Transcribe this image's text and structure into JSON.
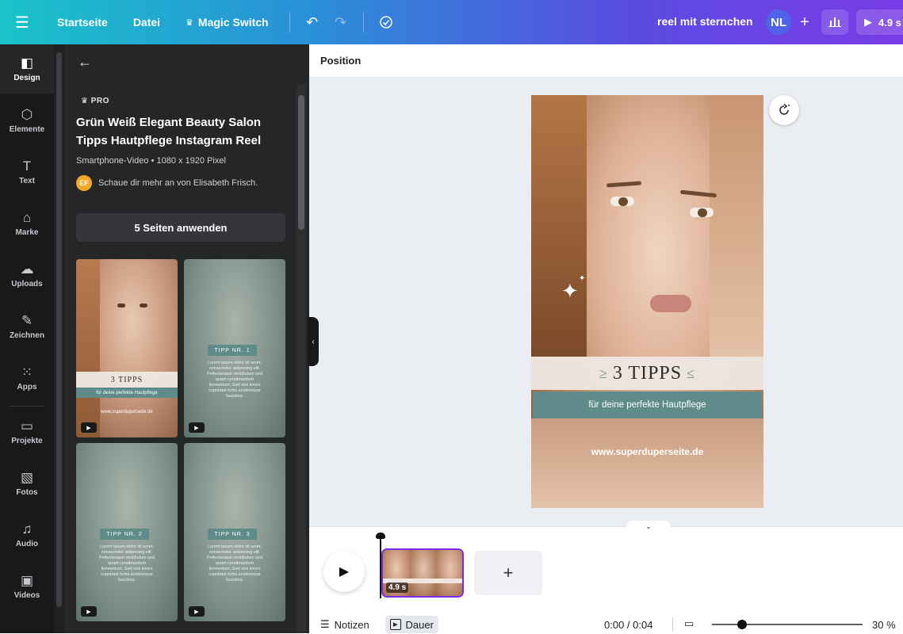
{
  "topbar": {
    "menu_icon": "hamburger-icon",
    "home": "Startseite",
    "file": "Datei",
    "magic_switch": "Magic Switch",
    "magic_icon": "crown-icon",
    "undo_icon": "undo-icon",
    "redo_icon": "redo-icon",
    "save_status_icon": "cloud-check-icon",
    "design_title": "reel mit sternchen",
    "avatar_initials": "NL",
    "add_icon": "plus-icon",
    "stats_icon": "bar-chart-icon",
    "play_label": "4.9 s",
    "accent_start": "#19c3c9",
    "accent_end": "#7a3ce6"
  },
  "rail": {
    "items": [
      {
        "label": "Design",
        "icon": "layout-icon"
      },
      {
        "label": "Elemente",
        "icon": "shapes-icon"
      },
      {
        "label": "Text",
        "icon": "text-icon"
      },
      {
        "label": "Marke",
        "icon": "brand-icon"
      },
      {
        "label": "Uploads",
        "icon": "cloud-upload-icon"
      },
      {
        "label": "Zeichnen",
        "icon": "draw-icon"
      },
      {
        "label": "Apps",
        "icon": "apps-grid-icon"
      },
      {
        "label": "Projekte",
        "icon": "folder-icon"
      },
      {
        "label": "Fotos",
        "icon": "image-icon"
      },
      {
        "label": "Audio",
        "icon": "music-icon"
      },
      {
        "label": "Videos",
        "icon": "video-icon"
      }
    ]
  },
  "panel": {
    "pro_label": "PRO",
    "title": "Grün Weiß Elegant Beauty Salon Tipps Hautpflege Instagram Reel",
    "subtitle": "Smartphone-Video • 1080 x 1920 Pixel",
    "author_initials": "EF",
    "author_text": "Schaue dir mehr an von Elisabeth Frisch.",
    "apply_button": "5 Seiten anwenden",
    "thumbnails": [
      {
        "heading": "3 TIPPS",
        "sub": "für deine perfekte Hautpflege",
        "url": "www.superduperseite.de"
      },
      {
        "tipp": "TIPP NR. 1",
        "body": "Lorem ipsum dolor sit amet, consectetur adipiscing elit. Pellentesque vestibulum sed quam condimentum fermentum. Sed non lorem cupidatat fortia scelerisque faucibus."
      },
      {
        "tipp": "TIPP NR. 2",
        "body": "Lorem ipsum dolor sit amet, consectetur adipiscing elit. Pellentesque vestibulum sed quam condimentum fermentum. Sed non lorem cupidatat fortia scelerisque faucibus."
      },
      {
        "tipp": "TIPP NR. 3",
        "body": "Lorem ipsum dolor sit amet, consectetur adipiscing elit. Pellentesque vestibulum sed quam condimentum fermentum. Sed non lorem cupidatat fortia scelerisque faucibus."
      }
    ]
  },
  "editor": {
    "toolbar_position": "Position",
    "page": {
      "heading": "3 TIPPS",
      "subheading": "für deine perfekte Hautpflege",
      "url": "www.superduperseite.de",
      "teal": "#5f8c8a"
    },
    "refresh_icon": "regenerate-icon"
  },
  "timeline": {
    "clip_duration": "4.9 s",
    "add_icon": "plus-icon",
    "notes_label": "Notizen",
    "duration_label": "Dauer",
    "time": "0:00 / 0:04",
    "zoom": "30 %",
    "zoom_level": 0.2
  }
}
